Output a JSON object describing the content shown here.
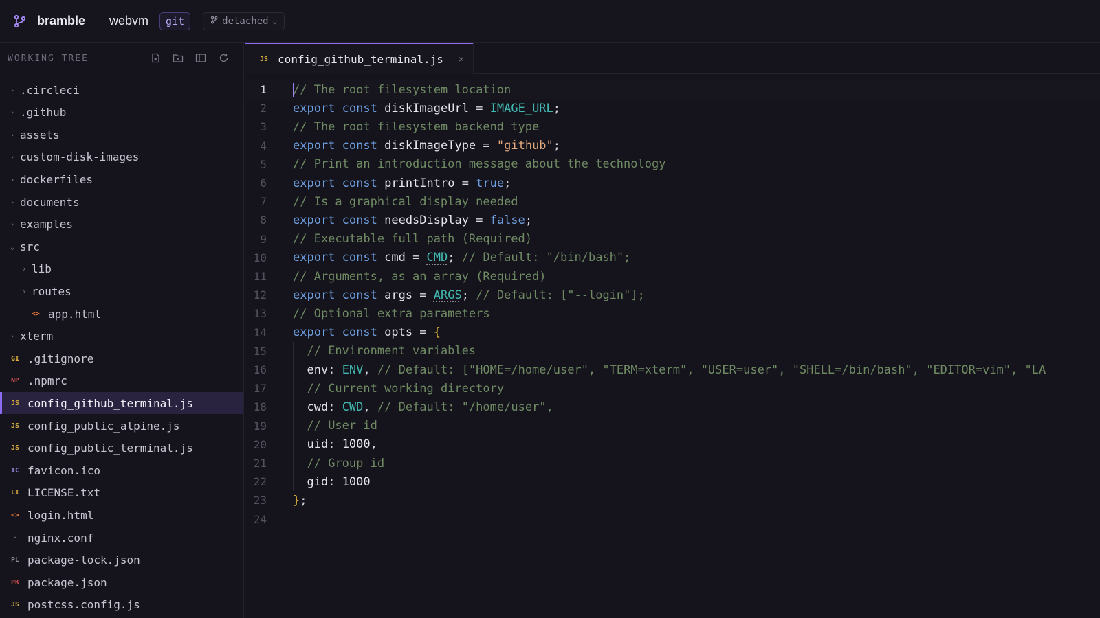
{
  "topbar": {
    "brand": "bramble",
    "repo": "webvm",
    "vcs": "git",
    "branch": "detached"
  },
  "sidebar": {
    "title": "WORKING TREE",
    "actions": [
      "new-file-icon",
      "new-folder-icon",
      "split-view-icon",
      "refresh-icon"
    ],
    "items": [
      {
        "label": ".circleci",
        "type": "folder",
        "depth": 0,
        "open": false
      },
      {
        "label": ".github",
        "type": "folder",
        "depth": 0,
        "open": false
      },
      {
        "label": "assets",
        "type": "folder",
        "depth": 0,
        "open": false
      },
      {
        "label": "custom-disk-images",
        "type": "folder",
        "depth": 0,
        "open": false
      },
      {
        "label": "dockerfiles",
        "type": "folder",
        "depth": 0,
        "open": false
      },
      {
        "label": "documents",
        "type": "folder",
        "depth": 0,
        "open": false
      },
      {
        "label": "examples",
        "type": "folder",
        "depth": 0,
        "open": false
      },
      {
        "label": "src",
        "type": "folder",
        "depth": 0,
        "open": true
      },
      {
        "label": "lib",
        "type": "folder",
        "depth": 1,
        "open": false
      },
      {
        "label": "routes",
        "type": "folder",
        "depth": 1,
        "open": false
      },
      {
        "label": "app.html",
        "type": "file",
        "depth": 1,
        "badge": "<>",
        "badge_color": "#e0763a"
      },
      {
        "label": "xterm",
        "type": "folder",
        "depth": 0,
        "open": false
      },
      {
        "label": ".gitignore",
        "type": "file",
        "depth": 0,
        "badge": "GI",
        "badge_color": "#e0b13c"
      },
      {
        "label": ".npmrc",
        "type": "file",
        "depth": 0,
        "badge": "NP",
        "badge_color": "#d9534f"
      },
      {
        "label": "config_github_terminal.js",
        "type": "file",
        "depth": 0,
        "badge": "JS",
        "badge_color": "#d2a93e",
        "selected": true
      },
      {
        "label": "config_public_alpine.js",
        "type": "file",
        "depth": 0,
        "badge": "JS",
        "badge_color": "#d2a93e"
      },
      {
        "label": "config_public_terminal.js",
        "type": "file",
        "depth": 0,
        "badge": "JS",
        "badge_color": "#d2a93e"
      },
      {
        "label": "favicon.ico",
        "type": "file",
        "depth": 0,
        "badge": "IC",
        "badge_color": "#9b8ce8"
      },
      {
        "label": "LICENSE.txt",
        "type": "file",
        "depth": 0,
        "badge": "LI",
        "badge_color": "#e0b13c"
      },
      {
        "label": "login.html",
        "type": "file",
        "depth": 0,
        "badge": "<>",
        "badge_color": "#e0763a"
      },
      {
        "label": "nginx.conf",
        "type": "file",
        "depth": 0,
        "badge": "·",
        "badge_color": "#6d6a7a"
      },
      {
        "label": "package-lock.json",
        "type": "file",
        "depth": 0,
        "badge": "PL",
        "badge_color": "#8a8796"
      },
      {
        "label": "package.json",
        "type": "file",
        "depth": 0,
        "badge": "PK",
        "badge_color": "#d9534f"
      },
      {
        "label": "postcss.config.js",
        "type": "file",
        "depth": 0,
        "badge": "JS",
        "badge_color": "#d2a93e"
      }
    ]
  },
  "tabs": [
    {
      "label": "config_github_terminal.js",
      "badge": "JS",
      "close": "×"
    }
  ],
  "editor": {
    "active_line": 1,
    "lines": [
      [
        [
          "cm",
          "// The root filesystem location"
        ]
      ],
      [
        [
          "kw",
          "export"
        ],
        [
          "op",
          " "
        ],
        [
          "kw",
          "const"
        ],
        [
          "op",
          " "
        ],
        [
          "id",
          "diskImageUrl"
        ],
        [
          "op",
          " = "
        ],
        [
          "cst",
          "IMAGE_URL"
        ],
        [
          "op",
          ";"
        ]
      ],
      [
        [
          "cm",
          "// The root filesystem backend type"
        ]
      ],
      [
        [
          "kw",
          "export"
        ],
        [
          "op",
          " "
        ],
        [
          "kw",
          "const"
        ],
        [
          "op",
          " "
        ],
        [
          "id",
          "diskImageType"
        ],
        [
          "op",
          " = "
        ],
        [
          "str",
          "\"github\""
        ],
        [
          "op",
          ";"
        ]
      ],
      [
        [
          "cm",
          "// Print an introduction message about the technology"
        ]
      ],
      [
        [
          "kw",
          "export"
        ],
        [
          "op",
          " "
        ],
        [
          "kw",
          "const"
        ],
        [
          "op",
          " "
        ],
        [
          "id",
          "printIntro"
        ],
        [
          "op",
          " = "
        ],
        [
          "bool",
          "true"
        ],
        [
          "op",
          ";"
        ]
      ],
      [
        [
          "cm",
          "// Is a graphical display needed"
        ]
      ],
      [
        [
          "kw",
          "export"
        ],
        [
          "op",
          " "
        ],
        [
          "kw",
          "const"
        ],
        [
          "op",
          " "
        ],
        [
          "id",
          "needsDisplay"
        ],
        [
          "op",
          " = "
        ],
        [
          "bool",
          "false"
        ],
        [
          "op",
          ";"
        ]
      ],
      [
        [
          "cm",
          "// Executable full path (Required)"
        ]
      ],
      [
        [
          "kw",
          "export"
        ],
        [
          "op",
          " "
        ],
        [
          "kw",
          "const"
        ],
        [
          "op",
          " "
        ],
        [
          "id",
          "cmd"
        ],
        [
          "op",
          " = "
        ],
        [
          "cstu",
          "CMD"
        ],
        [
          "op",
          "; "
        ],
        [
          "cm",
          "// Default: \"/bin/bash\";"
        ]
      ],
      [
        [
          "cm",
          "// Arguments, as an array (Required)"
        ]
      ],
      [
        [
          "kw",
          "export"
        ],
        [
          "op",
          " "
        ],
        [
          "kw",
          "const"
        ],
        [
          "op",
          " "
        ],
        [
          "id",
          "args"
        ],
        [
          "op",
          " = "
        ],
        [
          "cstu",
          "ARGS"
        ],
        [
          "op",
          "; "
        ],
        [
          "cm",
          "// Default: [\"--login\"];"
        ]
      ],
      [
        [
          "cm",
          "// Optional extra parameters"
        ]
      ],
      [
        [
          "kw",
          "export"
        ],
        [
          "op",
          " "
        ],
        [
          "kw",
          "const"
        ],
        [
          "op",
          " "
        ],
        [
          "id",
          "opts"
        ],
        [
          "op",
          " = "
        ],
        [
          "br",
          "{"
        ]
      ],
      [
        [
          "op",
          "  "
        ],
        [
          "cm",
          "// Environment variables"
        ]
      ],
      [
        [
          "op",
          "  "
        ],
        [
          "id",
          "env"
        ],
        [
          "op",
          ": "
        ],
        [
          "cst",
          "ENV"
        ],
        [
          "op",
          ", "
        ],
        [
          "cm",
          "// Default: [\"HOME=/home/user\", \"TERM=xterm\", \"USER=user\", \"SHELL=/bin/bash\", \"EDITOR=vim\", \"LA"
        ]
      ],
      [
        [
          "op",
          "  "
        ],
        [
          "cm",
          "// Current working directory"
        ]
      ],
      [
        [
          "op",
          "  "
        ],
        [
          "id",
          "cwd"
        ],
        [
          "op",
          ": "
        ],
        [
          "cst",
          "CWD"
        ],
        [
          "op",
          ", "
        ],
        [
          "cm",
          "// Default: \"/home/user\","
        ]
      ],
      [
        [
          "op",
          "  "
        ],
        [
          "cm",
          "// User id"
        ]
      ],
      [
        [
          "op",
          "  "
        ],
        [
          "id",
          "uid"
        ],
        [
          "op",
          ": "
        ],
        [
          "num",
          "1000"
        ],
        [
          "op",
          ","
        ]
      ],
      [
        [
          "op",
          "  "
        ],
        [
          "cm",
          "// Group id"
        ]
      ],
      [
        [
          "op",
          "  "
        ],
        [
          "id",
          "gid"
        ],
        [
          "op",
          ": "
        ],
        [
          "num",
          "1000"
        ]
      ],
      [
        [
          "br",
          "}"
        ],
        [
          "op",
          ";"
        ]
      ],
      []
    ]
  }
}
